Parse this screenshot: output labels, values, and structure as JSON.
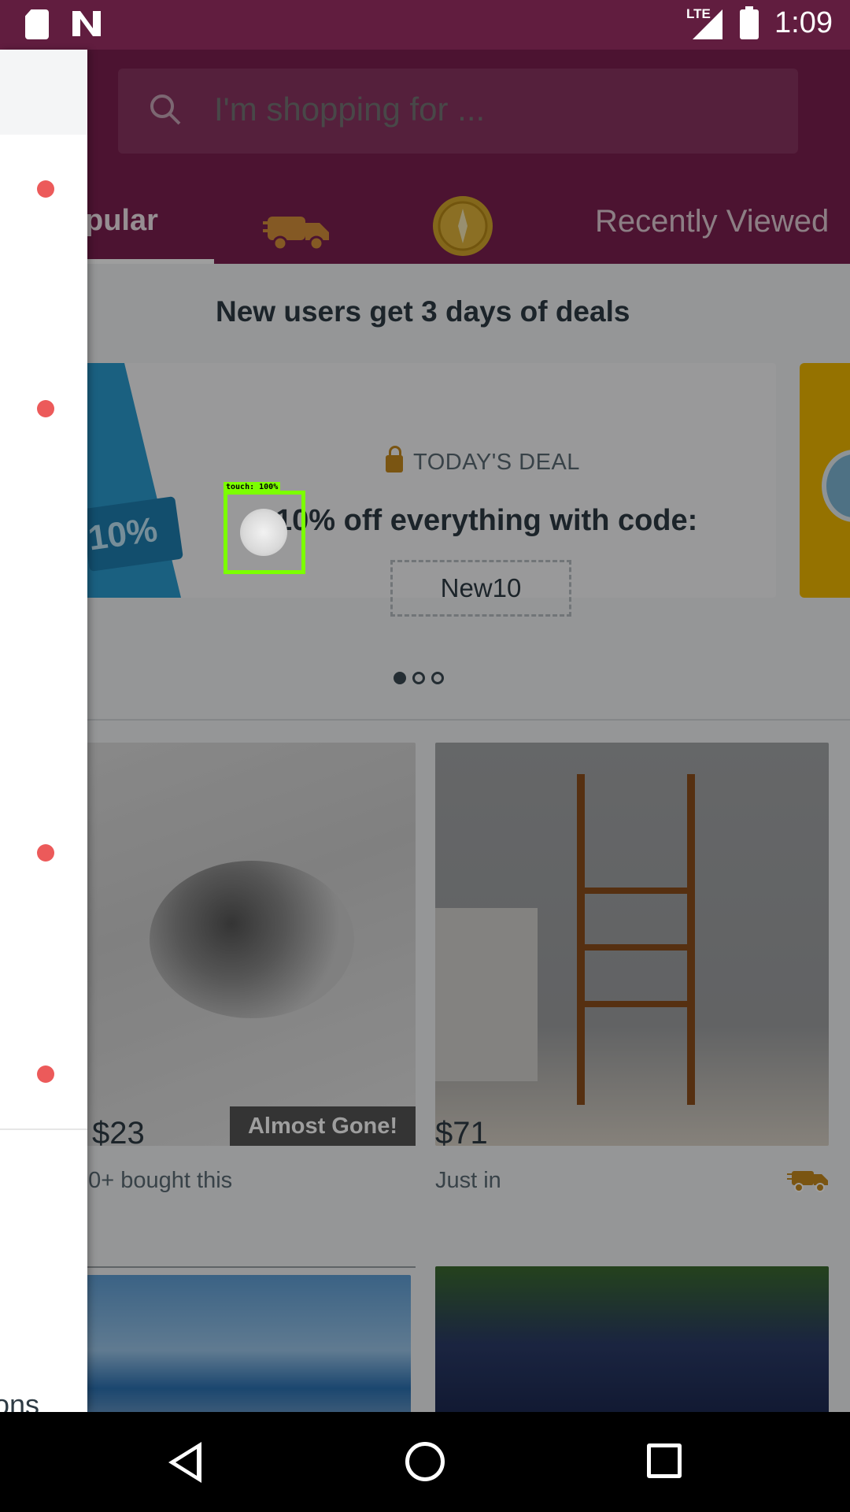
{
  "status_bar": {
    "time": "1:09",
    "network": "LTE"
  },
  "search": {
    "placeholder": "I'm shopping for ..."
  },
  "tabs": [
    {
      "label": "pular"
    },
    {
      "label": "",
      "icon": "truck-icon"
    },
    {
      "label": "",
      "icon": "coin-icon"
    },
    {
      "label": "Recently Viewed"
    }
  ],
  "promo": {
    "title": "New users get 3 days of deals",
    "ticket_label": "10%",
    "kicker": "TODAY'S DEAL",
    "headline": "10% off everything with code:",
    "code": "New10"
  },
  "carousel": {
    "pages": 3,
    "active": 0
  },
  "products": [
    {
      "price": "$23",
      "subtitle": "00+ bought this",
      "badge": "Almost Gone!"
    },
    {
      "price": "$71",
      "subtitle": "Just in",
      "badge": ""
    },
    {
      "price": "",
      "subtitle": "",
      "badge": ""
    },
    {
      "price": "",
      "subtitle": "",
      "badge": ""
    }
  ],
  "drawer": {
    "partial_text": "ons"
  },
  "touch_overlay": {
    "label": "touch: 100%"
  },
  "colors": {
    "brand": "#7b1f4f",
    "status_bar": "#611d3f",
    "drawer_dot": "#ec5a5a",
    "touch_box": "#7cff00",
    "shipping_accent": "#c68a1e"
  }
}
